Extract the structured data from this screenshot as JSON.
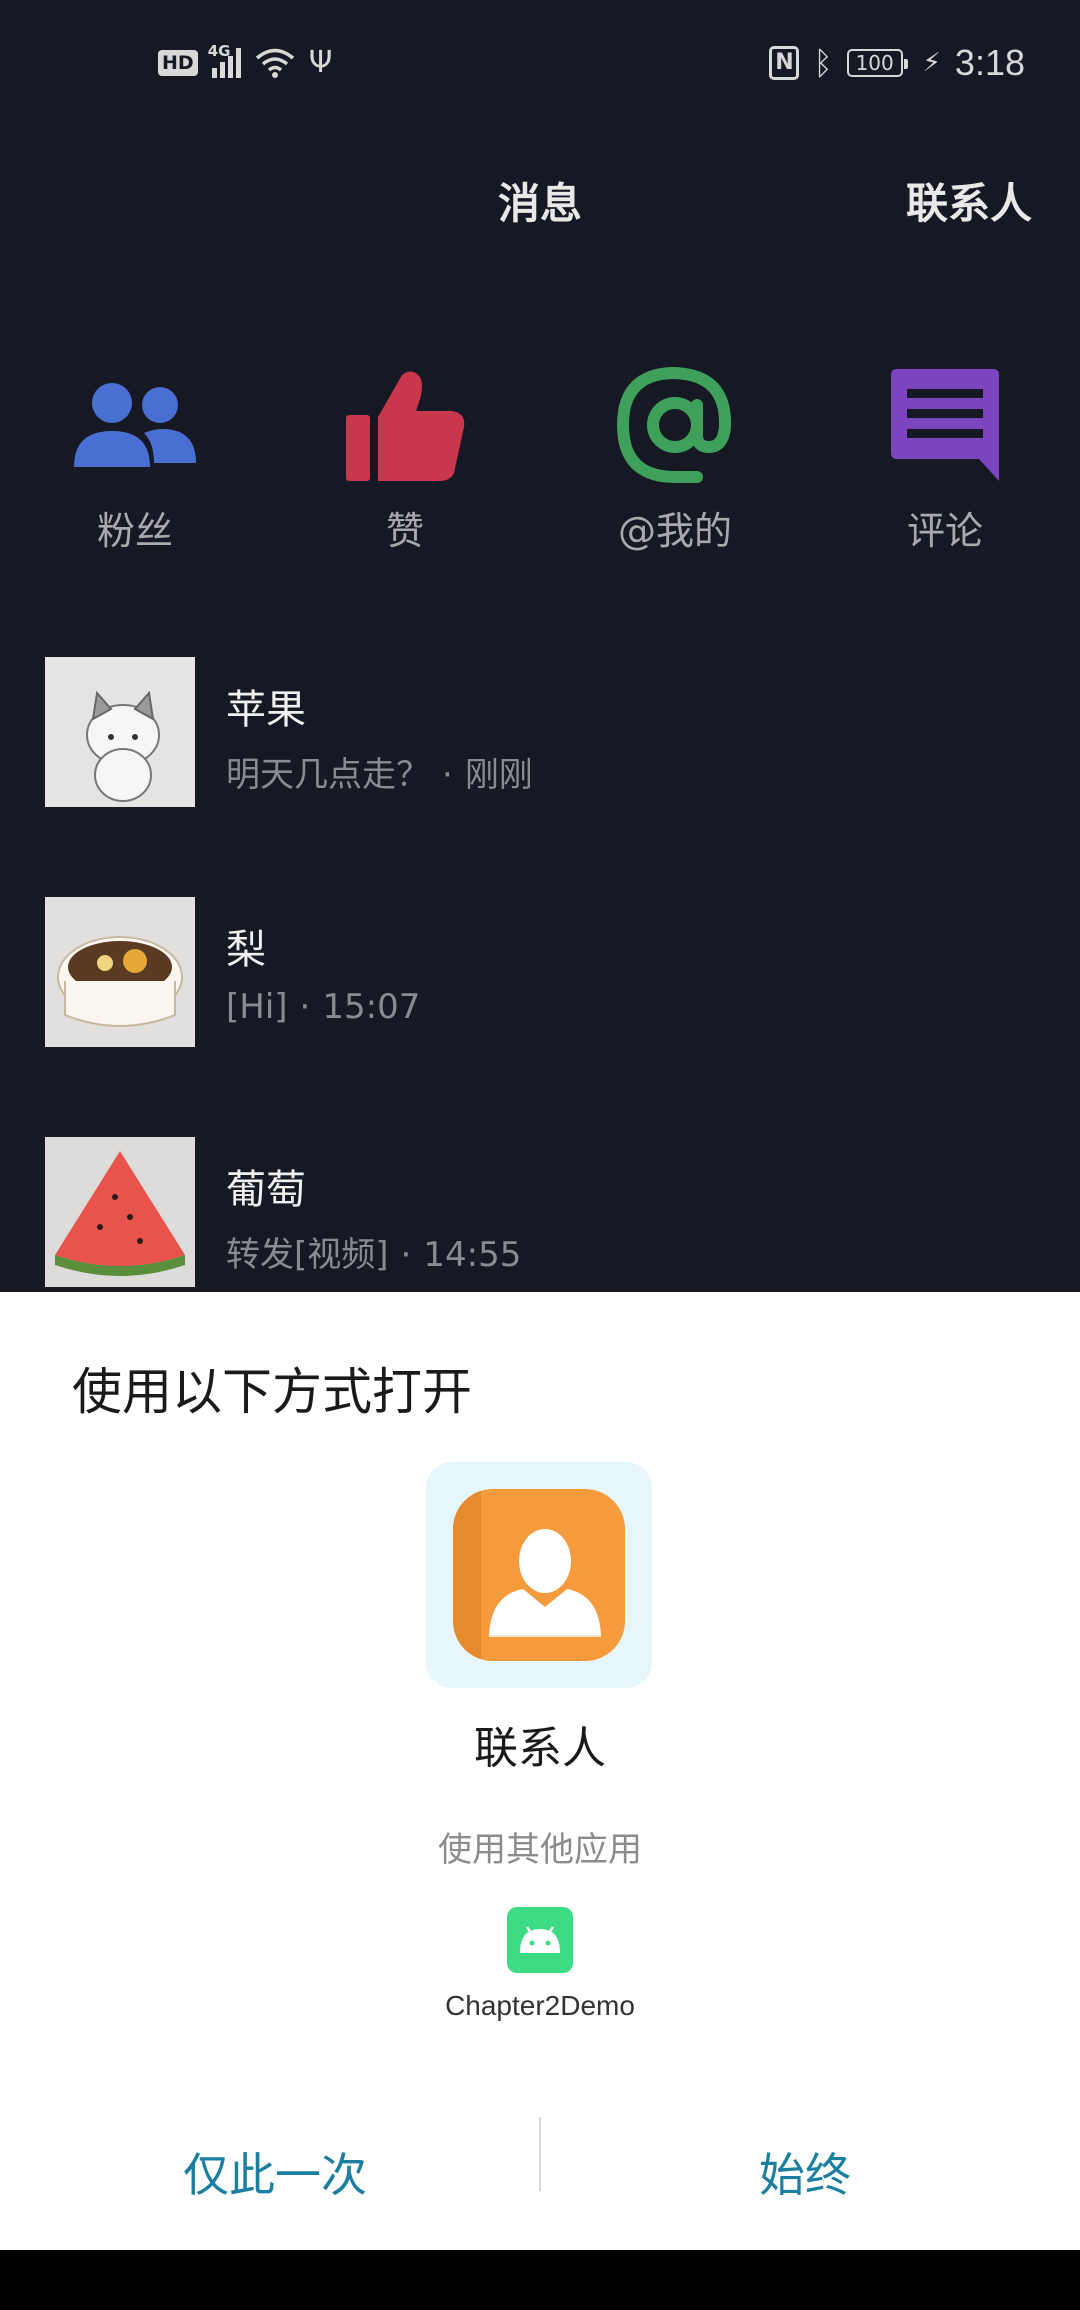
{
  "status_bar": {
    "hd_badge": "HD",
    "network": "4G",
    "battery": "100",
    "time": "3:18",
    "nfc": "N"
  },
  "header": {
    "title": "消息",
    "contacts_link": "联系人"
  },
  "quick_actions": [
    {
      "label": "粉丝",
      "icon": "fans-icon",
      "color": "#4a6fd3"
    },
    {
      "label": "赞",
      "icon": "thumbs-up-icon",
      "color": "#c8374b"
    },
    {
      "label": "@我的",
      "icon": "at-icon",
      "color": "#3ea05a"
    },
    {
      "label": "评论",
      "icon": "comment-icon",
      "color": "#7b45bf"
    }
  ],
  "messages": [
    {
      "name": "苹果",
      "preview": "明天几点走？",
      "dot": "·",
      "time": "刚刚"
    },
    {
      "name": "梨",
      "preview": "[Hi]",
      "dot": "·",
      "time": "15:07"
    },
    {
      "name": "葡萄",
      "preview": "转发[视频]",
      "dot": "·",
      "time": "14:55"
    }
  ],
  "sheet": {
    "title": "使用以下方式打开",
    "app_name": "联系人",
    "other_apps_label": "使用其他应用",
    "other_app_name": "Chapter2Demo",
    "button_once": "仅此一次",
    "button_always": "始终"
  },
  "colors": {
    "background": "#161823",
    "accent": "#1a7fa0",
    "contacts_icon": "#f59a3d",
    "android_green": "#3ddc84"
  }
}
